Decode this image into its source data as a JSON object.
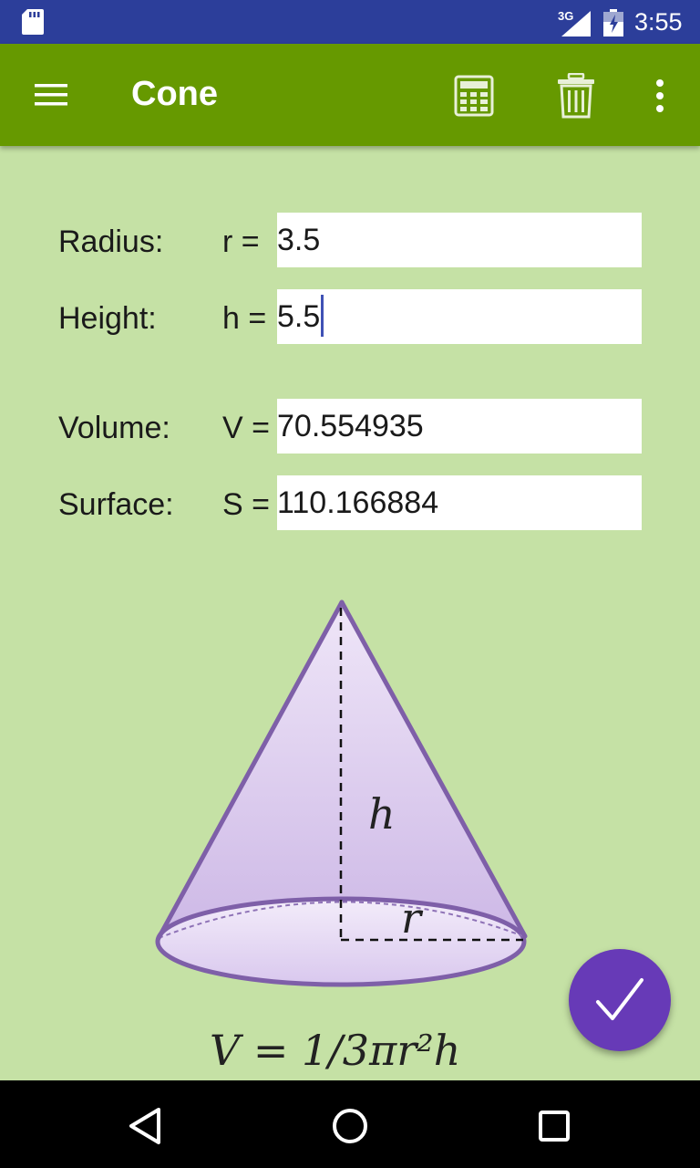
{
  "status_bar": {
    "network": "3G",
    "time": "3:55"
  },
  "app_bar": {
    "title": "Cone",
    "icons": [
      "menu-icon",
      "calculator-icon",
      "trash-icon",
      "more-vert-icon"
    ]
  },
  "form": {
    "radius": {
      "label": "Radius:",
      "symbol": "r =",
      "value": "3.5"
    },
    "height": {
      "label": "Height:",
      "symbol": "h =",
      "value": "5.5"
    },
    "volume": {
      "label": "Volume:",
      "symbol": "V =",
      "value": "70.554935"
    },
    "surface": {
      "label": "Surface:",
      "symbol": "S =",
      "value": "110.166884"
    }
  },
  "diagram": {
    "height_label": "h",
    "radius_label": "r",
    "formula": "V = 1/3πr²h",
    "fill_color": "#d7c8ec",
    "stroke_color": "#7e5fa8"
  },
  "fab": {
    "icon": "checkmark-icon",
    "color": "#673ab7"
  },
  "nav_bar": {
    "icons": [
      "back-icon",
      "home-icon",
      "recents-icon"
    ]
  },
  "colors": {
    "status_bar": "#2c3e9a",
    "app_bar": "#669900",
    "background": "#c5e1a5"
  }
}
